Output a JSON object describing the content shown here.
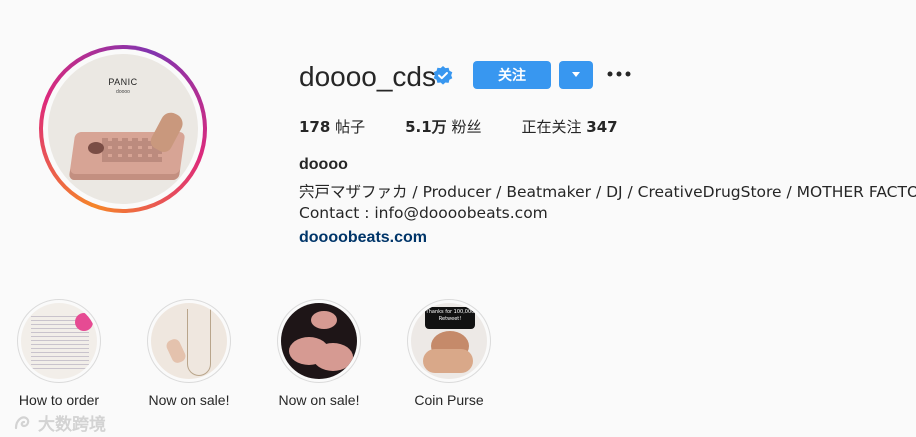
{
  "profile": {
    "username": "doooo_cds",
    "follow_label": "关注",
    "avatar_title": "PANIC",
    "avatar_sub": "doooo"
  },
  "stats": [
    {
      "value": "178",
      "label": "帖子"
    },
    {
      "value": "5.1万",
      "label": "粉丝"
    },
    {
      "label": "正在关注",
      "value": "347"
    }
  ],
  "bio": {
    "name": "doooo",
    "description": "宍戸マザファカ / Producer / Beatmaker / DJ / CreativeDrugStore / MOTHER FACTORY",
    "contact": "Contact : info@doooobeats.com",
    "link": "doooobeats.com"
  },
  "highlights": [
    {
      "label": "How to order"
    },
    {
      "label": "Now on sale!"
    },
    {
      "label": "Now on sale!"
    },
    {
      "label": "Coin Purse",
      "banner_text": "Thanks for 100,000 Retweet!"
    }
  ],
  "watermark": "大数跨境",
  "colors": {
    "accent": "#3897f0",
    "link": "#003569",
    "text": "#262626",
    "background": "#fafafa"
  },
  "icons": [
    "verified-badge-icon",
    "chevron-down-icon",
    "more-options-icon"
  ]
}
